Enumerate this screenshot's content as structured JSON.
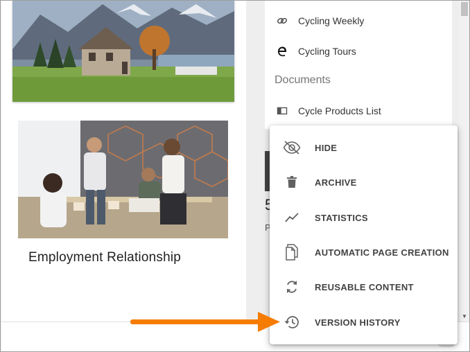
{
  "right_list": {
    "items": [
      {
        "label": "Cycling Weekly",
        "icon": "link-icon"
      },
      {
        "label": "Cycling Tours",
        "icon": "edge-icon"
      }
    ],
    "section_label": "Documents",
    "documents": [
      {
        "label": "Cycle Products List",
        "icon": "table-icon"
      }
    ]
  },
  "left_cards": {
    "bottom_title": "Employment Relationship"
  },
  "peek": {
    "big": "5",
    "small": "P"
  },
  "context_menu": {
    "items": [
      {
        "label": "HIDE",
        "icon": "eye-off-icon"
      },
      {
        "label": "ARCHIVE",
        "icon": "trash-icon"
      },
      {
        "label": "STATISTICS",
        "icon": "chart-line-icon"
      },
      {
        "label": "AUTOMATIC PAGE CREATION",
        "icon": "copy-pages-icon"
      },
      {
        "label": "REUSABLE CONTENT",
        "icon": "refresh-icon"
      },
      {
        "label": "VERSION HISTORY",
        "icon": "history-icon"
      }
    ]
  },
  "colors": {
    "arrow": "#f57c00",
    "menu_text": "#424242",
    "icon": "#616161"
  }
}
